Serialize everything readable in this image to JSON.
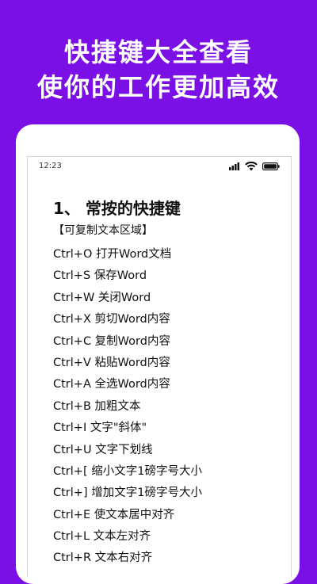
{
  "promo": {
    "line1": "快捷键大全查看",
    "line2": "使你的工作更加高效"
  },
  "status_bar": {
    "time": "12:23",
    "icons": [
      "signal-icon",
      "wifi-icon",
      "battery-icon"
    ]
  },
  "content": {
    "heading": "1、 常按的快捷键",
    "copy_note": "【可复制文本区域】",
    "shortcuts": [
      "Ctrl+O 打开Word文档",
      "Ctrl+S 保存Word",
      "Ctrl+W 关闭Word",
      "Ctrl+X 剪切Word内容",
      "Ctrl+C 复制Word内容",
      "Ctrl+V 粘贴Word内容",
      "Ctrl+A 全选Word内容",
      "Ctrl+B 加粗文本",
      "Ctrl+I 文字\"斜体\"",
      "Ctrl+U 文字下划线",
      "Ctrl+[ 缩小文字1磅字号大小",
      "Ctrl+] 增加文字1磅字号大小",
      "Ctrl+E 使文本居中对齐",
      "Ctrl+L 文本左对齐",
      "Ctrl+R 文本右对齐"
    ]
  },
  "colors": {
    "background": "#7a0fe6",
    "card": "#ffffff",
    "text": "#111111"
  }
}
